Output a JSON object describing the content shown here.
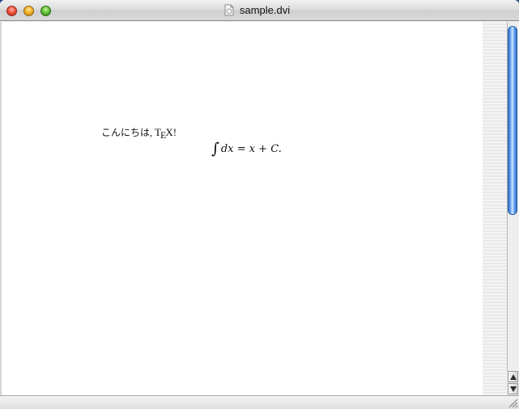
{
  "window": {
    "title": "sample.dvi"
  },
  "document": {
    "greeting_text": "こんにちは,",
    "tex_logo": {
      "t": "T",
      "e": "E",
      "x": "X",
      "exclamation": "!"
    },
    "formula": {
      "integral_symbol": "∫",
      "expression": "dx = x + C."
    }
  },
  "icons": {
    "doc_proxy": "document-icon",
    "close": "close-button",
    "minimize": "minimize-button",
    "zoom": "zoom-button",
    "scroll_up": "arrow-up-icon",
    "scroll_down": "arrow-down-icon",
    "resize": "resize-grip-icon"
  },
  "colors": {
    "accent_thumb": "#4a8fe6",
    "close": "#f0553f",
    "minimize": "#f2b52a",
    "zoom": "#63c33a"
  }
}
